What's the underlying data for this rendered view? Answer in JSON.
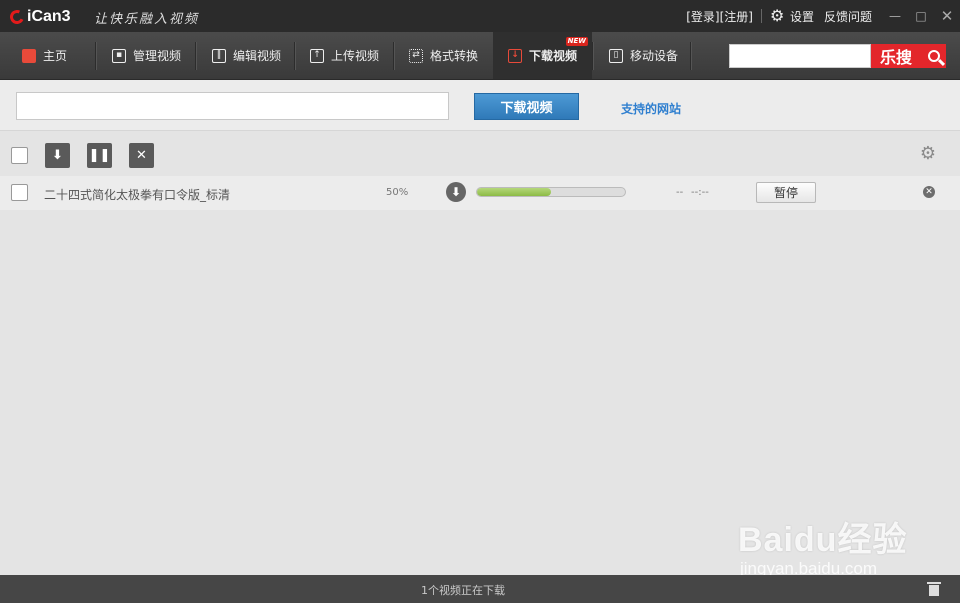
{
  "app": {
    "logo": "iCan3",
    "slogan": "让快乐融入视频",
    "login": "[登录]",
    "register": "[注册]",
    "settings": "设置",
    "feedback": "反馈问题"
  },
  "nav": {
    "items": [
      {
        "label": "主页",
        "icon": "home-icon"
      },
      {
        "label": "管理视频",
        "icon": "manage-video-icon"
      },
      {
        "label": "编辑视频",
        "icon": "edit-video-icon"
      },
      {
        "label": "上传视频",
        "icon": "upload-icon"
      },
      {
        "label": "格式转换",
        "icon": "convert-icon"
      },
      {
        "label": "下载视频",
        "icon": "download-icon",
        "active": true,
        "badge": "NEW"
      },
      {
        "label": "移动设备",
        "icon": "mobile-device-icon"
      }
    ],
    "search_button": "乐搜"
  },
  "url_bar": {
    "input_value": "",
    "download_button": "下载视频",
    "supported_sites": "支持的网站"
  },
  "downloads": [
    {
      "title": "二十四式简化太极拳有口令版_标清",
      "percent_text": "50%",
      "progress": 0.5,
      "speed": "--",
      "time_left": "--:--",
      "action": "暂停"
    }
  ],
  "status": {
    "text": "1个视频正在下载"
  },
  "watermark": {
    "brand": "Baidu经验",
    "url": "jingyan.baidu.com"
  },
  "colors": {
    "accent": "#e3262b",
    "primary_button": "#2f79b8",
    "progress": "#8cbb45"
  }
}
